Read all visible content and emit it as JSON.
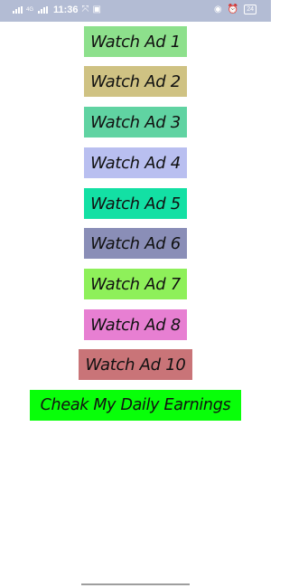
{
  "status_bar": {
    "time": "11:36",
    "network_label": "4G",
    "battery_text": "24"
  },
  "buttons": [
    {
      "label": "Watch Ad 1",
      "color": "#8de08c"
    },
    {
      "label": "Watch Ad 2",
      "color": "#cfc283"
    },
    {
      "label": "Watch Ad 3",
      "color": "#60d3a2"
    },
    {
      "label": "Watch Ad 4",
      "color": "#b9bff0"
    },
    {
      "label": "Watch Ad 5",
      "color": "#13e0a4"
    },
    {
      "label": "Watch Ad 6",
      "color": "#8a8eb7"
    },
    {
      "label": "Watch Ad 7",
      "color": "#8ef05a"
    },
    {
      "label": "Watch Ad 8",
      "color": "#e77fd2"
    },
    {
      "label": "Watch Ad 10",
      "color": "#c97478"
    }
  ],
  "earnings_button": {
    "label": "Cheak My Daily Earnings",
    "color": "#08ff09"
  }
}
